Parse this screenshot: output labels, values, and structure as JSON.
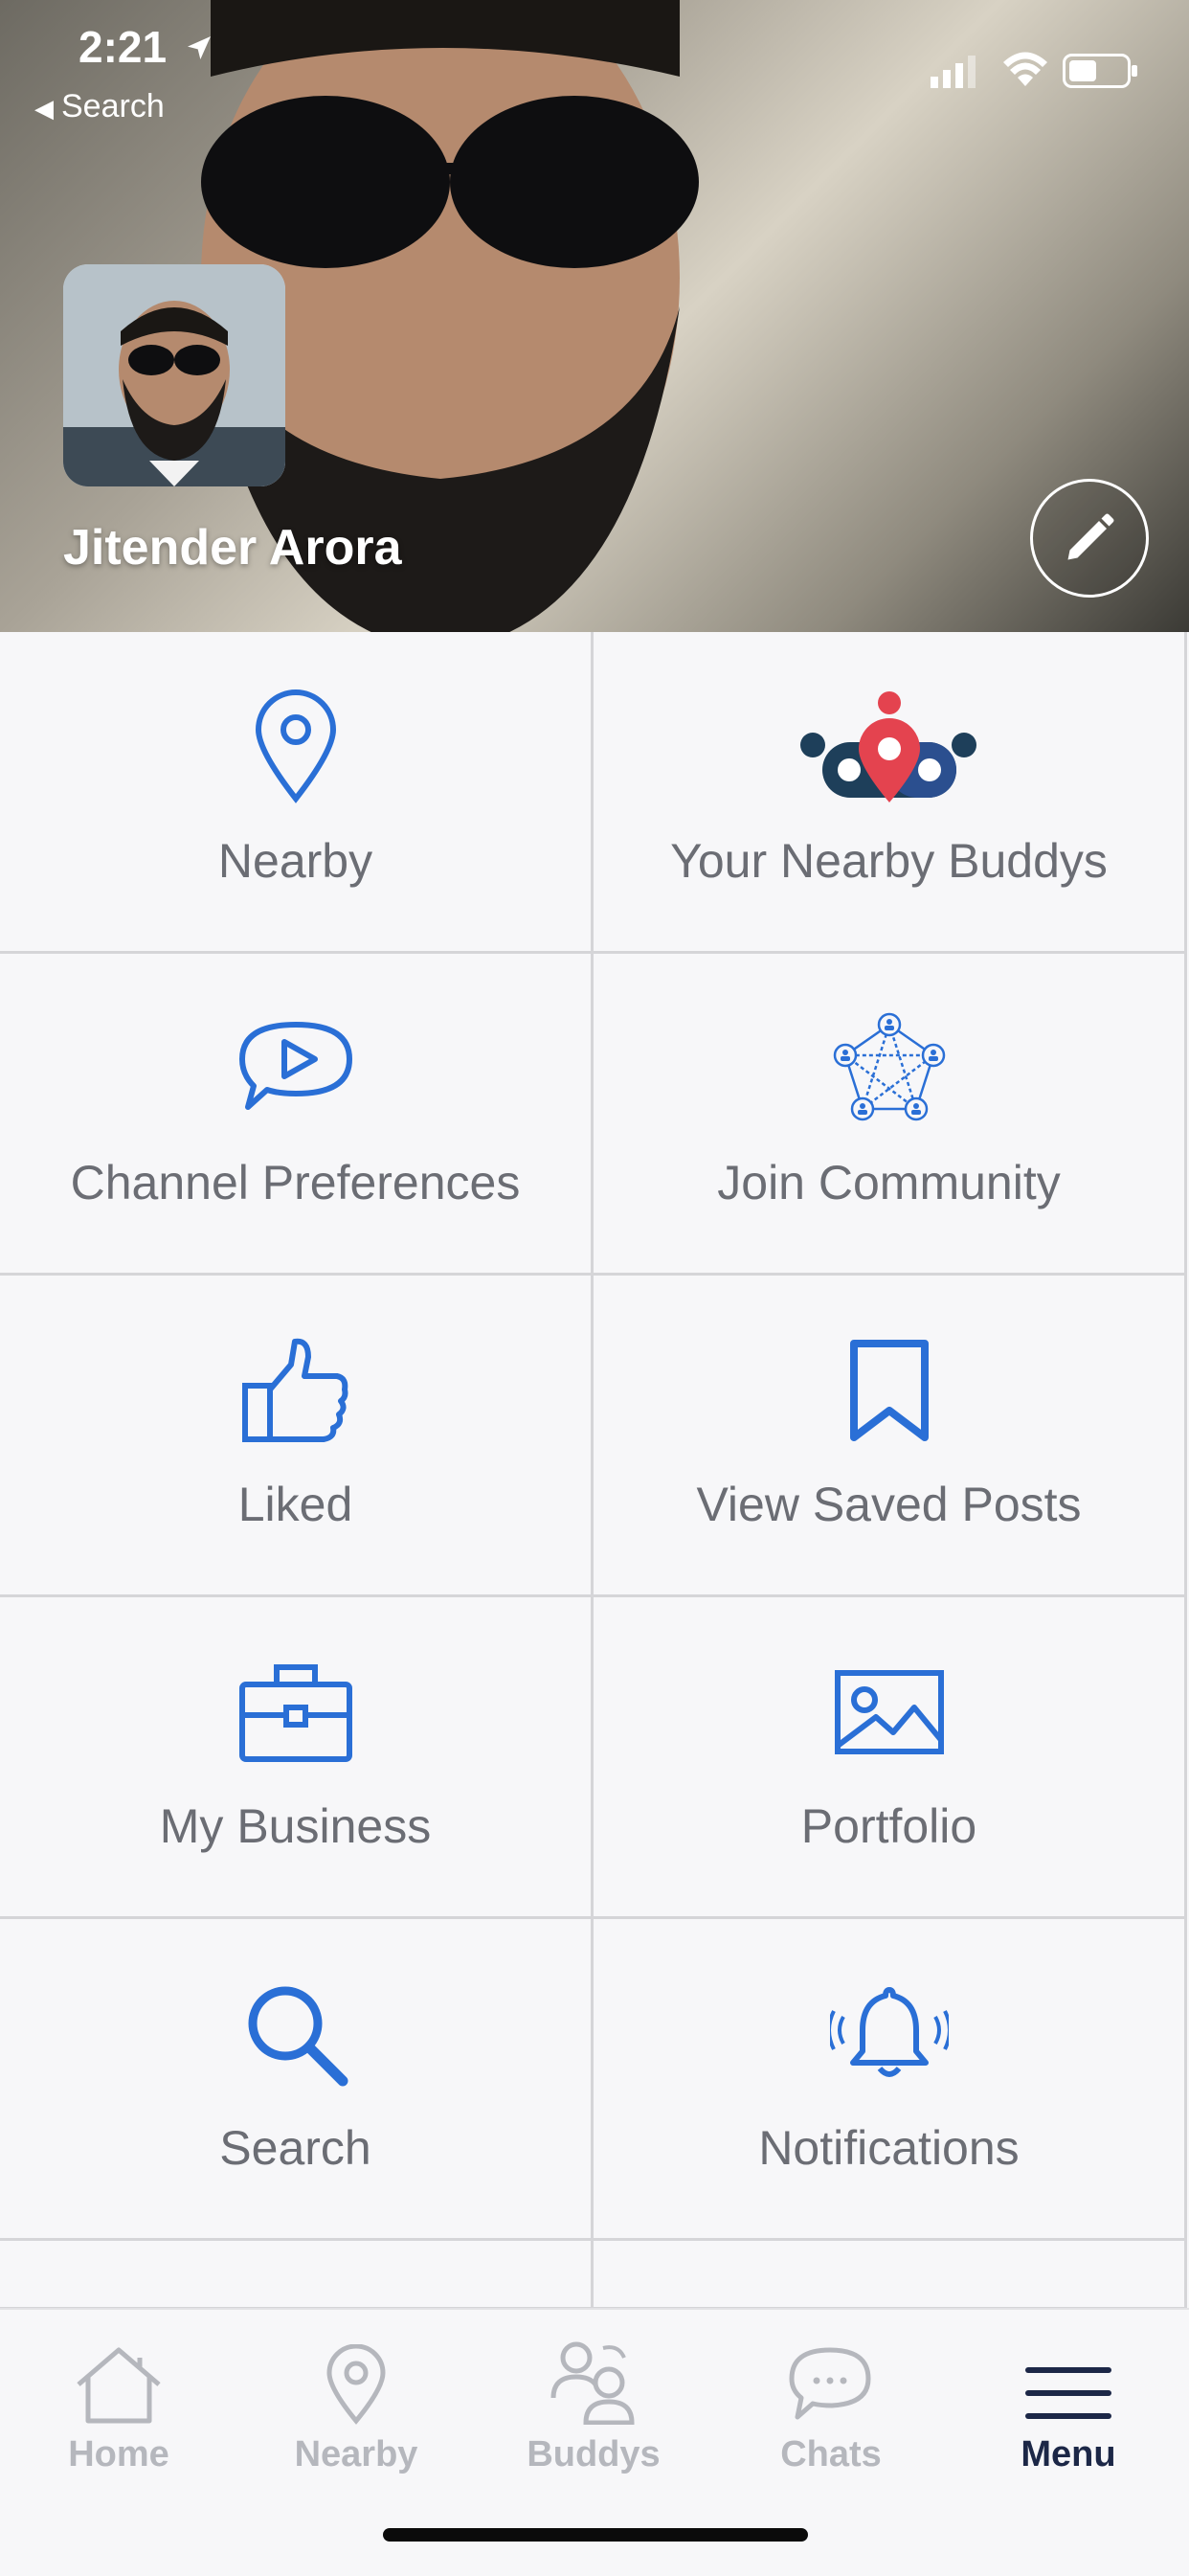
{
  "status": {
    "time": "2:21",
    "back_label": "Search"
  },
  "profile": {
    "name": "Jitender Arora"
  },
  "menu": [
    {
      "label": "Nearby",
      "icon": "location-pin-icon"
    },
    {
      "label": "Your Nearby Buddys",
      "icon": "buddys-logo-icon"
    },
    {
      "label": "Channel Preferences",
      "icon": "play-chat-icon"
    },
    {
      "label": "Join Community",
      "icon": "community-network-icon"
    },
    {
      "label": "Liked",
      "icon": "thumbs-up-icon"
    },
    {
      "label": "View Saved Posts",
      "icon": "bookmark-icon"
    },
    {
      "label": "My Business",
      "icon": "briefcase-icon"
    },
    {
      "label": "Portfolio",
      "icon": "image-icon"
    },
    {
      "label": "Search",
      "icon": "search-icon"
    },
    {
      "label": "Notifications",
      "icon": "bell-icon"
    }
  ],
  "tabbar": {
    "items": [
      {
        "label": "Home",
        "icon": "home-icon"
      },
      {
        "label": "Nearby",
        "icon": "location-pin-icon"
      },
      {
        "label": "Buddys",
        "icon": "people-icon"
      },
      {
        "label": "Chats",
        "icon": "chat-bubble-icon"
      },
      {
        "label": "Menu",
        "icon": "hamburger-menu-icon"
      }
    ],
    "active": "Menu"
  },
  "colors": {
    "accent": "#2a6fd6",
    "active_tab": "#1c2747",
    "inactive_tab": "#b5b7bd",
    "label": "#6b6d74"
  }
}
